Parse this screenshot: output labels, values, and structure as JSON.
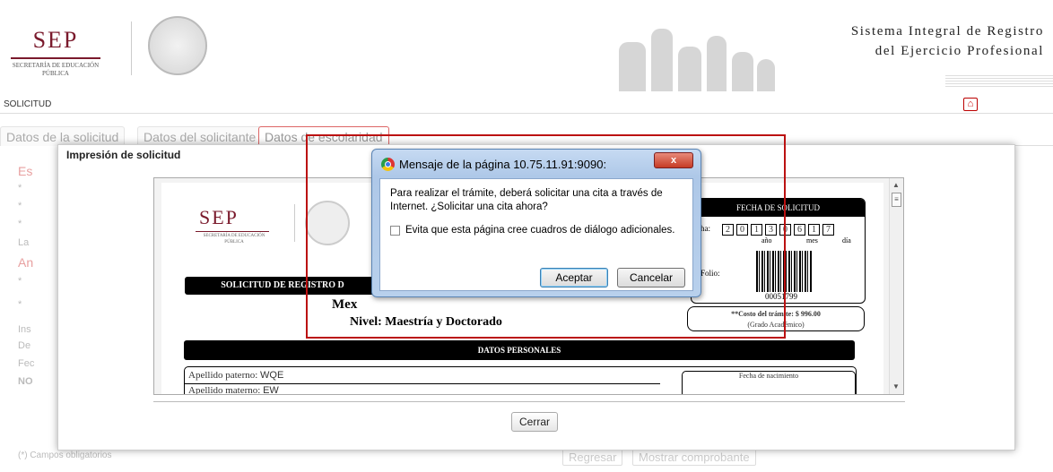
{
  "header": {
    "logo_text": "SEP",
    "logo_sub": "SECRETARÍA DE EDUCACIÓN PÚBLICA",
    "app_title_line1": "Sistema Integral de Registro",
    "app_title_line2": "del Ejercicio Profesional"
  },
  "menubar": {
    "label": "SOLICITUD",
    "home_icon": "home-icon"
  },
  "tabs": [
    {
      "label": "Datos de la solicitud"
    },
    {
      "label": "Datos del solicitante"
    },
    {
      "label": "Datos de escolaridad"
    }
  ],
  "background": {
    "red1": "Es",
    "red2": "An",
    "bullets": [
      "*",
      "*",
      "*",
      "*",
      "*"
    ],
    "la": "La",
    "ins": "Ins",
    "de": "De",
    "fec": "Fec",
    "no": "NO",
    "required_note": "(*) Campos obligatorios",
    "back_button": "Regresar",
    "show_button": "Mostrar comprobante"
  },
  "modal": {
    "title": "Impresión de solicitud",
    "close_button": "Cerrar",
    "document": {
      "logo": "SEP",
      "logo_sub": "SECRETARÍA DE EDUCACIÓN PÚBLICA",
      "request_title": "SOLICITUD DE REGISTRO D",
      "mex_text": "Mex",
      "nivel": "Nivel: Maestría y Doctorado",
      "fecha_title": "FECHA DE SOLICITUD",
      "fecha_label": "echa:",
      "fecha_digits": [
        "2",
        "0",
        "1",
        "3",
        "0",
        "6",
        "1",
        "7"
      ],
      "fecha_year": "año",
      "fecha_month": "mes",
      "fecha_day": "día",
      "folio_label": "Folio:",
      "folio_number": "00051799",
      "costo_line1": "**Costo del trámite: $ 996.00",
      "costo_line2": "(Grado Académico)",
      "datos_title": "DATOS PERSONALES",
      "apellido_paterno_label": "Apellido paterno:",
      "apellido_paterno_value": "WQE",
      "apellido_materno_label": "Apellido materno:",
      "apellido_materno_value": "EW",
      "nacimiento_label": "Fecha de nacimiento"
    }
  },
  "dialog": {
    "title": "Mensaje de la página 10.75.11.91:9090:",
    "message": "Para realizar el trámite, deberá solicitar una cita a través de Internet. ¿Solicitar una cita ahora?",
    "checkbox_label": "Evita que esta página cree cuadros de diálogo adicionales.",
    "ok_button": "Aceptar",
    "cancel_button": "Cancelar",
    "close_symbol": "x"
  }
}
